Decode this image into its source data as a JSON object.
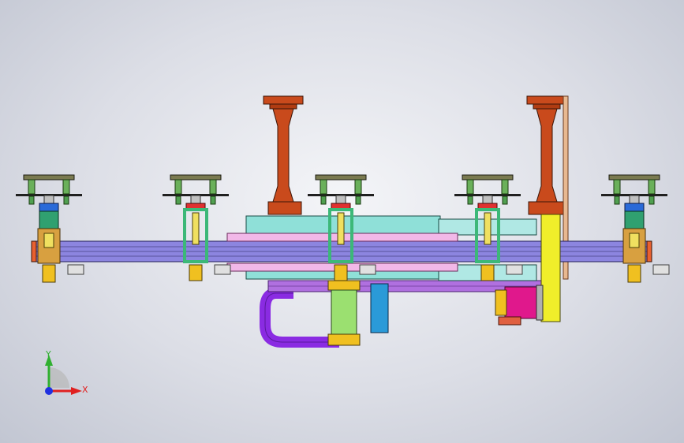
{
  "scene": {
    "name": "cad-assembly-view",
    "colors": {
      "background": "#dcdee6",
      "column": "#c94a1c",
      "beam": "#8c85e0",
      "plate_cyan": "#8fe0d8",
      "plate_pink": "#f2b8e8",
      "gripper_frame": "#3cb878",
      "cable_chain": "#8a2be2",
      "cylinder": "#9be070",
      "motor": "#e0188c",
      "guide_yellow": "#f0ee2a",
      "rack": "#b070e0",
      "sensor_blue": "#2a6ad8"
    }
  },
  "triad": {
    "x_label": "X",
    "y_label": "Y",
    "x_color": "#e02020",
    "y_color": "#30b030",
    "z_color": "#2030e0"
  }
}
